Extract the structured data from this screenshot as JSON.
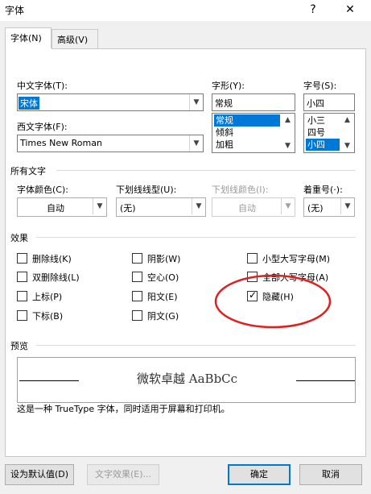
{
  "window": {
    "title": "字体",
    "help": "?",
    "close": "✕"
  },
  "tabs": [
    {
      "label": "字体(N)",
      "active": true
    },
    {
      "label": "高级(V)",
      "active": false
    }
  ],
  "font": {
    "chinese_label": "中文字体(T):",
    "chinese_value": "宋体",
    "western_label": "西文字体(F):",
    "western_value": "Times New Roman",
    "style_label": "字形(Y):",
    "style_value": "常规",
    "style_options": [
      "常规",
      "倾斜",
      "加粗"
    ],
    "size_label": "字号(S):",
    "size_value": "小四",
    "size_options": [
      "小三",
      "四号",
      "小四"
    ]
  },
  "all_text": {
    "heading": "所有文字",
    "color_label": "字体颜色(C):",
    "color_value": "自动",
    "underline_label": "下划线线型(U):",
    "underline_value": "(无)",
    "underline_color_label": "下划线颜色(I):",
    "underline_color_value": "自动",
    "emphasis_label": "着重号(·):",
    "emphasis_value": "(无)"
  },
  "effects": {
    "heading": "效果",
    "items": [
      {
        "label": "删除线(K)",
        "checked": false
      },
      {
        "label": "双删除线(L)",
        "checked": false
      },
      {
        "label": "上标(P)",
        "checked": false
      },
      {
        "label": "下标(B)",
        "checked": false
      },
      {
        "label": "阴影(W)",
        "checked": false
      },
      {
        "label": "空心(O)",
        "checked": false
      },
      {
        "label": "阳文(E)",
        "checked": false
      },
      {
        "label": "阴文(G)",
        "checked": false
      },
      {
        "label": "小型大写字母(M)",
        "checked": false
      },
      {
        "label": "全部大写字母(A)",
        "checked": false
      },
      {
        "label": "隐藏(H)",
        "checked": true
      }
    ]
  },
  "preview": {
    "heading": "预览",
    "sample": "微软卓越  AaBbCc",
    "note": "这是一种 TrueType 字体，同时适用于屏幕和打印机。"
  },
  "buttons": {
    "set_default": "设为默认值(D)",
    "text_effects": "文字效果(E)...",
    "ok": "确定",
    "cancel": "取消"
  },
  "colors": {
    "selection": "#0078d7",
    "annotation": "#e02020"
  }
}
